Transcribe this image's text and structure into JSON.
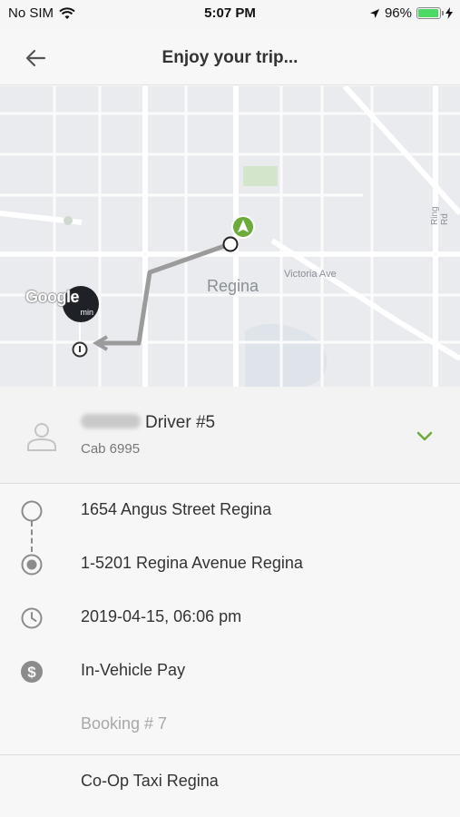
{
  "status_bar": {
    "carrier": "No SIM",
    "time": "5:07 PM",
    "battery": "96%",
    "battery_level": 0.96,
    "icons": [
      "wifi-icon",
      "location-arrow-icon",
      "battery-icon",
      "charging-bolt-icon"
    ]
  },
  "nav": {
    "title": "Enjoy your trip...",
    "back_icon": "back-arrow-icon"
  },
  "map": {
    "city_label": "Regina",
    "street_label": "Victoria Ave",
    "ring_label": "Ring Rd",
    "logo": "Google",
    "eta_unit": "min",
    "route_color": "#9b9b9b",
    "pickup_marker_color": "#6aab3c"
  },
  "driver": {
    "name": "Driver #5",
    "cab": "Cab 6995",
    "avatar_icon": "person-icon",
    "expand_icon": "chevron-down-icon",
    "accent_color": "#6aab3c"
  },
  "trip": {
    "pickup": "1654 Angus Street Regina",
    "dropoff": "1-5201 Regina Avenue Regina",
    "datetime": "2019-04-15, 06:06 pm",
    "payment": "In-Vehicle Pay",
    "booking": "Booking # 7"
  },
  "company": "Co-Op Taxi Regina"
}
